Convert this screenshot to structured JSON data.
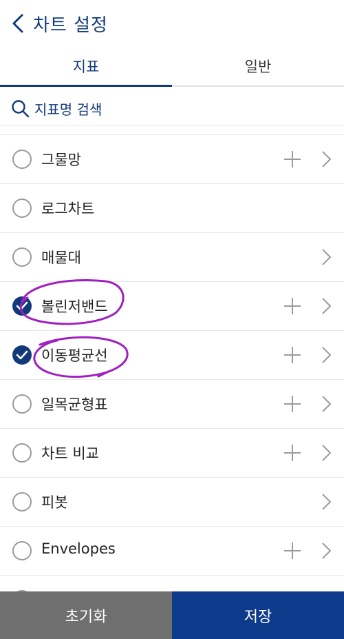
{
  "header": {
    "title": "차트 설정"
  },
  "tabs": [
    {
      "label": "지표",
      "active": true
    },
    {
      "label": "일반",
      "active": false
    }
  ],
  "search": {
    "placeholder": "지표명 검색"
  },
  "list": {
    "items": [
      {
        "label": "그물망",
        "checked": false,
        "has_add": true,
        "has_arrow": true
      },
      {
        "label": "로그차트",
        "checked": false,
        "has_add": false,
        "has_arrow": false
      },
      {
        "label": "매물대",
        "checked": false,
        "has_add": false,
        "has_arrow": true
      },
      {
        "label": "볼린저밴드",
        "checked": true,
        "has_add": true,
        "has_arrow": true
      },
      {
        "label": "이동평균선",
        "checked": true,
        "has_add": true,
        "has_arrow": true
      },
      {
        "label": "일목균형표",
        "checked": false,
        "has_add": true,
        "has_arrow": true
      },
      {
        "label": "차트 비교",
        "checked": false,
        "has_add": true,
        "has_arrow": true
      },
      {
        "label": "피봇",
        "checked": false,
        "has_add": false,
        "has_arrow": true
      },
      {
        "label": "Envelopes",
        "checked": false,
        "has_add": true,
        "has_arrow": true
      },
      {
        "label": "",
        "checked": false,
        "has_add": true,
        "has_arrow": true
      }
    ]
  },
  "footer": {
    "reset_label": "초기화",
    "save_label": "저장"
  },
  "colors": {
    "accent": "#123a7a",
    "save_button": "#0d3a8a",
    "reset_button": "#6f6f6f",
    "annotation": "#a020c0"
  }
}
